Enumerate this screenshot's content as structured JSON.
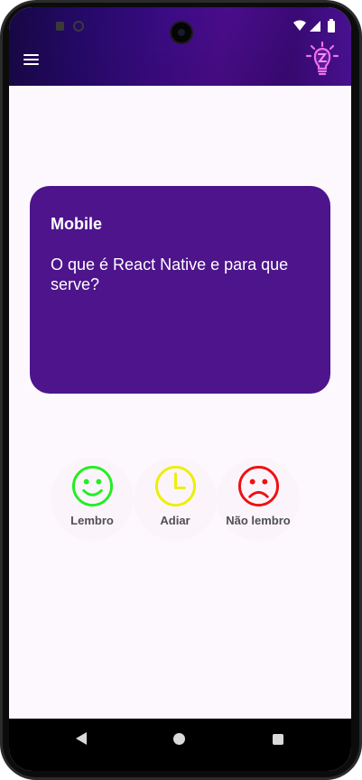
{
  "header": {
    "menu_icon": "hamburger-menu-icon",
    "logo_icon": "lightbulb-logo-icon"
  },
  "card": {
    "category": "Mobile",
    "question": "O que é React Native e para que serve?",
    "color": "#4d148c"
  },
  "actions": [
    {
      "label": "Lembro",
      "icon": "smile-face-icon",
      "color": "#22ee22"
    },
    {
      "label": "Adiar",
      "icon": "clock-icon",
      "color": "#eeee00"
    },
    {
      "label": "Não lembro",
      "icon": "sad-face-icon",
      "color": "#ee1111"
    }
  ],
  "navbar": {
    "back_icon": "back-triangle-icon",
    "home_icon": "home-circle-icon",
    "recents_icon": "recents-square-icon"
  }
}
